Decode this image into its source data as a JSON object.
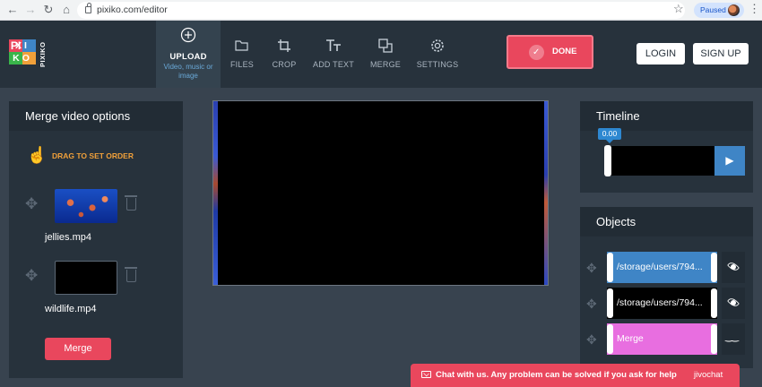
{
  "browser": {
    "url": "pixiko.com/editor",
    "profile_status": "Paused",
    "back_icon": "arrow-left",
    "forward_icon": "arrow-right",
    "reload_icon": "reload",
    "home_icon": "home",
    "star_icon": "star",
    "menu_icon": "kebab"
  },
  "header": {
    "logo": {
      "letters": [
        "PI",
        "XI",
        "KO"
      ],
      "side_text": "PIXIKO"
    },
    "tools": [
      {
        "label": "UPLOAD",
        "sub": "Video, music or image",
        "icon": "plus-circle"
      },
      {
        "label": "FILES",
        "icon": "folder"
      },
      {
        "label": "CROP",
        "icon": "crop"
      },
      {
        "label": "ADD TEXT",
        "icon": "text"
      },
      {
        "label": "MERGE",
        "icon": "merge"
      },
      {
        "label": "SETTINGS",
        "icon": "gear"
      }
    ],
    "done_label": "DONE",
    "login_label": "LOGIN",
    "signup_label": "SIGN UP"
  },
  "merge_panel": {
    "title": "Merge video options",
    "drag_hint": "DRAG TO SET ORDER",
    "clips": [
      {
        "filename": "jellies.mp4"
      },
      {
        "filename": "wildlife.mp4"
      }
    ],
    "merge_button": "Merge"
  },
  "timeline": {
    "title": "Timeline",
    "position": "0.00"
  },
  "objects": {
    "title": "Objects",
    "items": [
      {
        "name": "/storage/users/794...",
        "color": "#3f85c6",
        "visible": true
      },
      {
        "name": "/storage/users/794...",
        "color": "#000000",
        "visible": true
      },
      {
        "name": "Merge",
        "color": "#e86ee0",
        "visible": false
      }
    ]
  },
  "chat": {
    "text": "Chat with us. Any problem can be solved if you ask for help",
    "brand": "jivochat"
  },
  "colors": {
    "accent_red": "#e9475d",
    "accent_blue": "#3f85c6",
    "drag_hint": "#f0a03a",
    "panel_bg": "#27323c",
    "page_bg": "#38434f"
  }
}
